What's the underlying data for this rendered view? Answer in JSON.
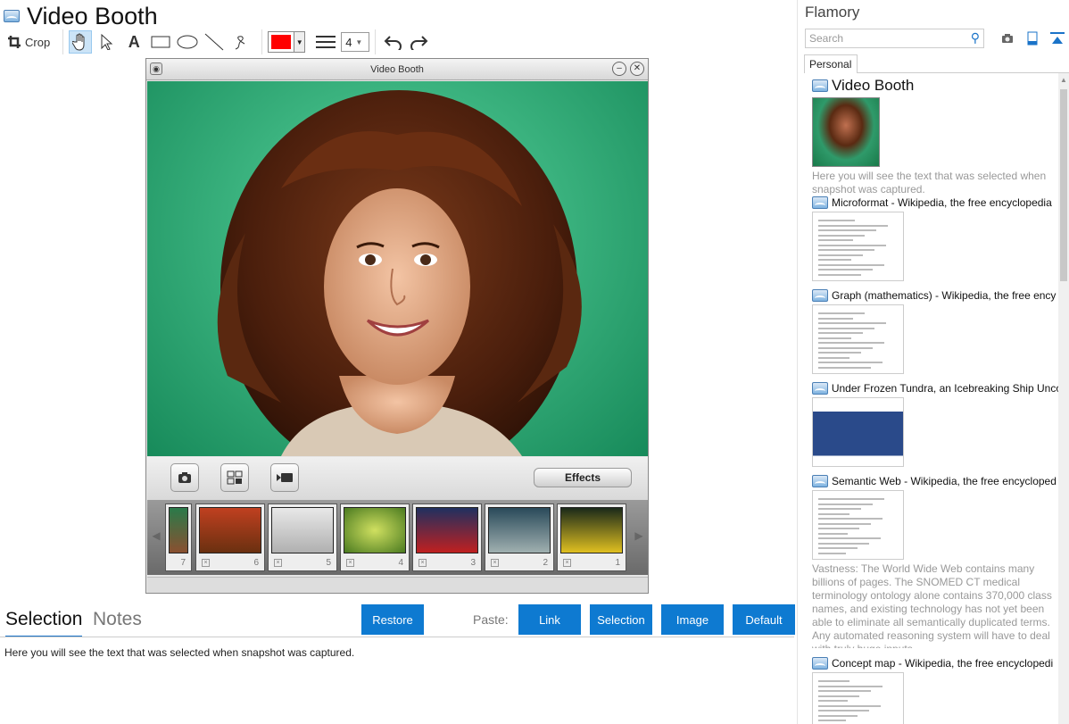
{
  "left": {
    "title": "Video Booth",
    "toolbar": {
      "crop_label": "Crop",
      "color": "#ff0000",
      "line_width": "4"
    },
    "video_booth": {
      "window_title": "Video Booth",
      "effects_label": "Effects",
      "thumbnails": [
        "7",
        "6",
        "5",
        "4",
        "3",
        "2",
        "1"
      ]
    },
    "tabs": {
      "selection": "Selection",
      "notes": "Notes"
    },
    "buttons": {
      "restore": "Restore",
      "paste_label": "Paste:",
      "link": "Link",
      "selection": "Selection",
      "image": "Image",
      "default": "Default"
    },
    "selection_text": "Here you will see the text that was selected when snapshot was captured."
  },
  "right": {
    "title": "Flamory",
    "search_placeholder": "Search",
    "tab": "Personal",
    "snapshots": [
      {
        "title": "Video Booth",
        "desc": "Here you will see the text that was selected when snapshot was captured."
      },
      {
        "title": "Microformat - Wikipedia, the free encyclopedia",
        "desc": ""
      },
      {
        "title": "Graph (mathematics) - Wikipedia, the free ency",
        "desc": ""
      },
      {
        "title": "Under Frozen Tundra, an Icebreaking Ship Unco",
        "desc": ""
      },
      {
        "title": "Semantic Web - Wikipedia, the free encycloped",
        "desc": "Vastness: The World Wide Web contains many billions of pages. The SNOMED CT medical terminology ontology alone contains 370,000 class names, and existing technology has not yet been able to eliminate all semantically duplicated terms. Any automated reasoning system will have to deal with truly huge inputs."
      },
      {
        "title": "Concept map - Wikipedia, the free encyclopedi",
        "desc": ""
      }
    ]
  },
  "colors": {
    "accent": "#0e7ad1",
    "tab_underline": "#1a73c8"
  }
}
